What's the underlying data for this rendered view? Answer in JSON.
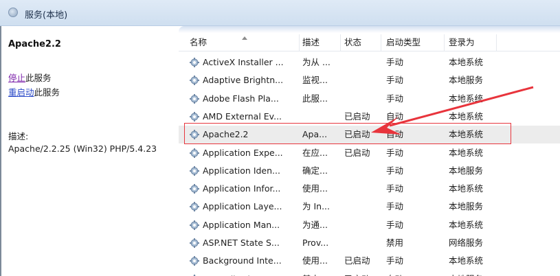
{
  "window": {
    "title": "服务(本地)"
  },
  "left_panel": {
    "service_title": "Apache2.2",
    "actions": [
      {
        "link": "停止",
        "rest": "此服务"
      },
      {
        "link": "重启动",
        "rest": "此服务"
      }
    ],
    "description_label": "描述:",
    "description_text": "Apache/2.2.25 (Win32) PHP/5.4.23"
  },
  "table": {
    "columns": [
      "名称",
      "描述",
      "状态",
      "启动类型",
      "登录为"
    ],
    "rows": [
      {
        "name": "ActiveX Installer ...",
        "desc": "为从 ...",
        "status": "",
        "startup": "手动",
        "logon": "本地系统"
      },
      {
        "name": "Adaptive Brightn...",
        "desc": "监视...",
        "status": "",
        "startup": "手动",
        "logon": "本地服务"
      },
      {
        "name": "Adobe Flash Pla...",
        "desc": "此服...",
        "status": "",
        "startup": "手动",
        "logon": "本地系统"
      },
      {
        "name": "AMD External Ev...",
        "desc": "",
        "status": "已启动",
        "startup": "自动",
        "logon": "本地系统"
      },
      {
        "name": "Apache2.2",
        "desc": "Apa...",
        "status": "已启动",
        "startup": "自动",
        "logon": "本地系统",
        "selected": true
      },
      {
        "name": "Application Expe...",
        "desc": "在应...",
        "status": "已启动",
        "startup": "手动",
        "logon": "本地系统"
      },
      {
        "name": "Application Iden...",
        "desc": "确定...",
        "status": "",
        "startup": "手动",
        "logon": "本地服务"
      },
      {
        "name": "Application Infor...",
        "desc": "使用...",
        "status": "",
        "startup": "手动",
        "logon": "本地系统"
      },
      {
        "name": "Application Laye...",
        "desc": "为 In...",
        "status": "",
        "startup": "手动",
        "logon": "本地服务"
      },
      {
        "name": "Application Man...",
        "desc": "为通...",
        "status": "",
        "startup": "手动",
        "logon": "本地系统"
      },
      {
        "name": "ASP.NET State S...",
        "desc": "Prov...",
        "status": "",
        "startup": "禁用",
        "logon": "网络服务"
      },
      {
        "name": "Background Inte...",
        "desc": "使用...",
        "status": "已启动",
        "startup": "手动",
        "logon": "本地系统"
      },
      {
        "name": "Base Filtering E...",
        "desc": "基本...",
        "status": "已启动",
        "startup": "自动",
        "logon": "本地服务"
      }
    ]
  },
  "icons": {
    "title": "services-icon",
    "row": "gear-icon"
  },
  "colors": {
    "highlight": "#e8343c",
    "link": "#2a49c8",
    "visited_link": "#7a1ea8",
    "selected_row": "#ececec"
  }
}
